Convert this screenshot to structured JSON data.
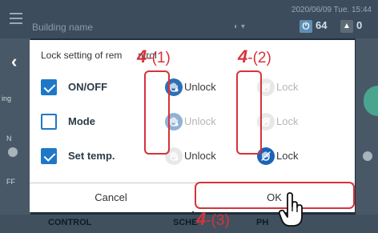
{
  "header": {
    "building": "Building name",
    "datetime": "2020/06/09 Tue. 15:44",
    "counter_on": "64",
    "counter_alert": "0"
  },
  "side": {
    "left_labels": [
      "ing",
      "N",
      "FF"
    ]
  },
  "bottom": {
    "tab_control": "CONTROL",
    "tab_schedule": "SCHE",
    "tab_graph": "PH"
  },
  "dialog": {
    "title": "Lock setting of rem",
    "title_tail": "ntrol",
    "rows": [
      {
        "label": "ON/OFF",
        "checked": true,
        "unlock": "Unlock",
        "lock": "Lock"
      },
      {
        "label": "Mode",
        "checked": false,
        "unlock": "Unlock",
        "lock": "Lock"
      },
      {
        "label": "Set temp.",
        "checked": true,
        "unlock": "Unlock",
        "lock": "Lock"
      }
    ],
    "cancel": "Cancel",
    "ok": "OK"
  },
  "callouts": {
    "c1_num": "4",
    "c1_sub": "-(1)",
    "c2_num": "4",
    "c2_sub": "-(2)",
    "c3_num": "4",
    "c3_sub": "-(3)"
  },
  "colors": {
    "accent": "#1e78c8",
    "callout_red": "#d6333a"
  }
}
